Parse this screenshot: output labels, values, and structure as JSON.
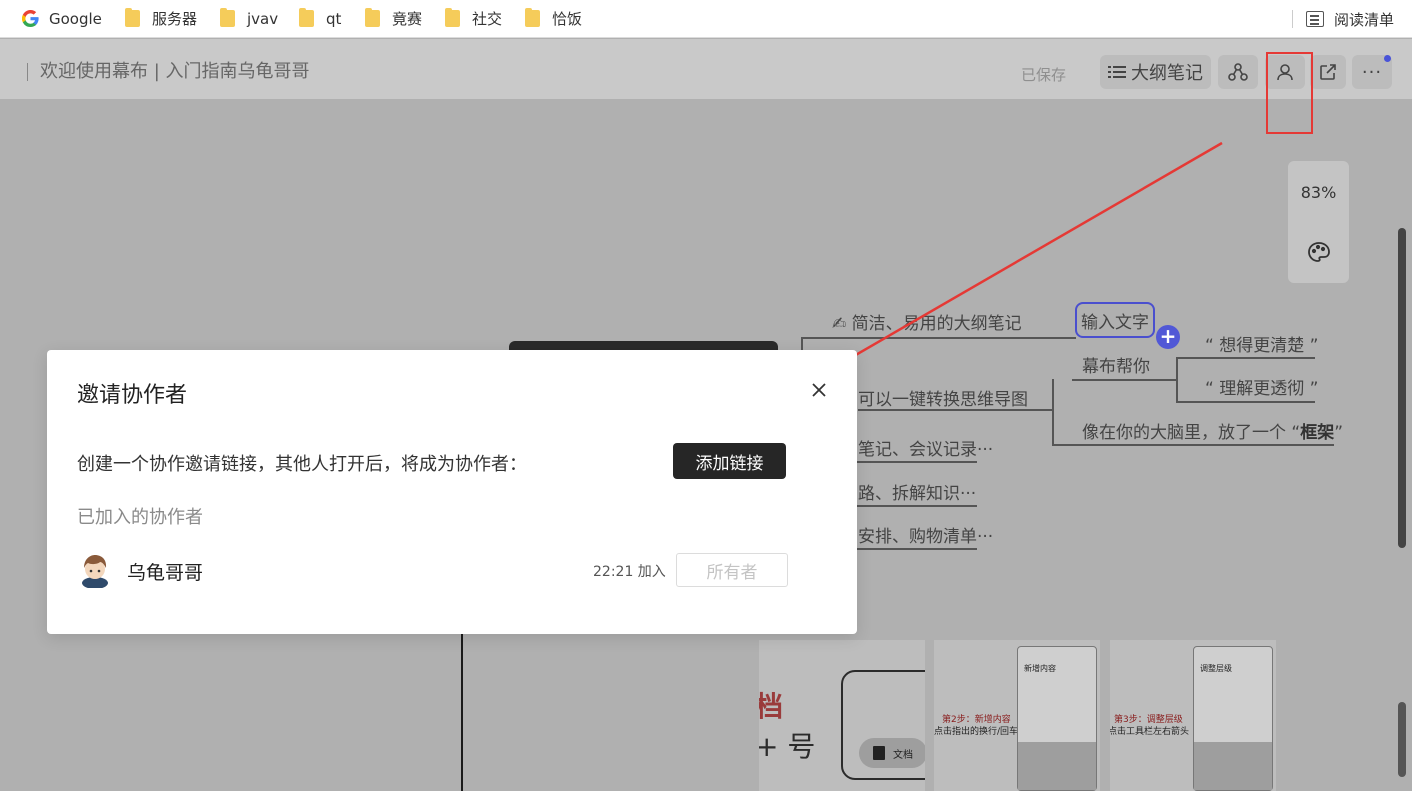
{
  "bookmarks": {
    "items": [
      {
        "label": "Google",
        "icon": "google-icon"
      },
      {
        "label": "服务器",
        "icon": "folder-icon"
      },
      {
        "label": "jvav",
        "icon": "folder-icon"
      },
      {
        "label": "qt",
        "icon": "folder-icon"
      },
      {
        "label": "竟赛",
        "icon": "folder-icon"
      },
      {
        "label": "社交",
        "icon": "folder-icon"
      },
      {
        "label": "恰饭",
        "icon": "folder-icon"
      }
    ],
    "reading_list": "阅读清单"
  },
  "header": {
    "doc_title": "欢迎使用幕布 | 入门指南乌龟哥哥",
    "saved_status": "已保存",
    "outline_label": "大纲笔记",
    "more_label": "···"
  },
  "zoom": {
    "value": "83%"
  },
  "mindmap": {
    "node_intro": "✍ 简洁、易用的大纲笔记",
    "node_input": "输入文字",
    "node_help": "幕布帮你",
    "node_think": "“ 想得更清楚 ”",
    "node_understand": "“ 理解更透彻 ”",
    "node_convert": "可以一键转换思维导图",
    "node_frame_prefix": "像在你的大脑里，放了一个 “",
    "node_frame_bold": "框架",
    "node_frame_suffix": "”",
    "node_notes": "笔记、会议记录···",
    "node_ideas": "路、拆解知识···",
    "node_plans": "安排、购物清单···"
  },
  "thumbnails": {
    "t1_line1": "档",
    "t1_line2": "+ 号",
    "t1_pill": "文档",
    "t2_step": "第2步：新增内容",
    "t2_desc": "点击指出的换行/回车",
    "t2_phone_title": "新增内容",
    "t3_step": "第3步：调整层级",
    "t3_desc": "点击工具栏左右箭头",
    "t3_phone_title": "调整层级"
  },
  "dialog": {
    "title": "邀请协作者",
    "description": "创建一个协作邀请链接，其他人打开后，将成为协作者：",
    "add_link_button": "添加链接",
    "joined_label": "已加入的协作者",
    "members": [
      {
        "name": "乌龟哥哥",
        "join_time": "22:21 加入",
        "role": "所有者"
      }
    ]
  },
  "colors": {
    "accent": "#4a4fce",
    "annotation_red": "#e53935",
    "dark_button": "#262626"
  }
}
